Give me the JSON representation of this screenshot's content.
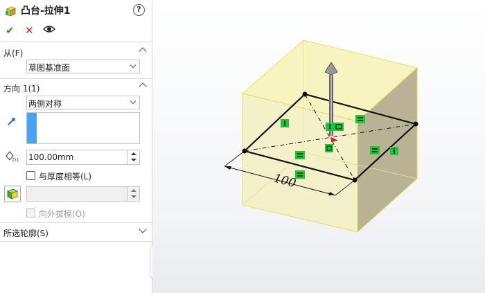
{
  "feature": {
    "title": "凸台-拉伸1",
    "help_label": "?"
  },
  "actions": {
    "ok": "✔",
    "cancel": "✕"
  },
  "from_section": {
    "title": "从(F)",
    "value": "草图基准面"
  },
  "direction1": {
    "title": "方向 1(1)",
    "end_condition": "两侧对称",
    "depth": "100.00mm",
    "thickness_equal_label": "与厚度相等(L)",
    "draft_outward_label": "向外拔模(O)"
  },
  "selected_contours": {
    "title": "所选轮廓(S)"
  },
  "viewport": {
    "dimension_text": "100"
  },
  "colors": {
    "accent": "#4aa3f0",
    "ok": "#2a9a2a",
    "cancel": "#d42020",
    "relation_badge": "#22c33a",
    "box_face": "#f5f2a0"
  }
}
